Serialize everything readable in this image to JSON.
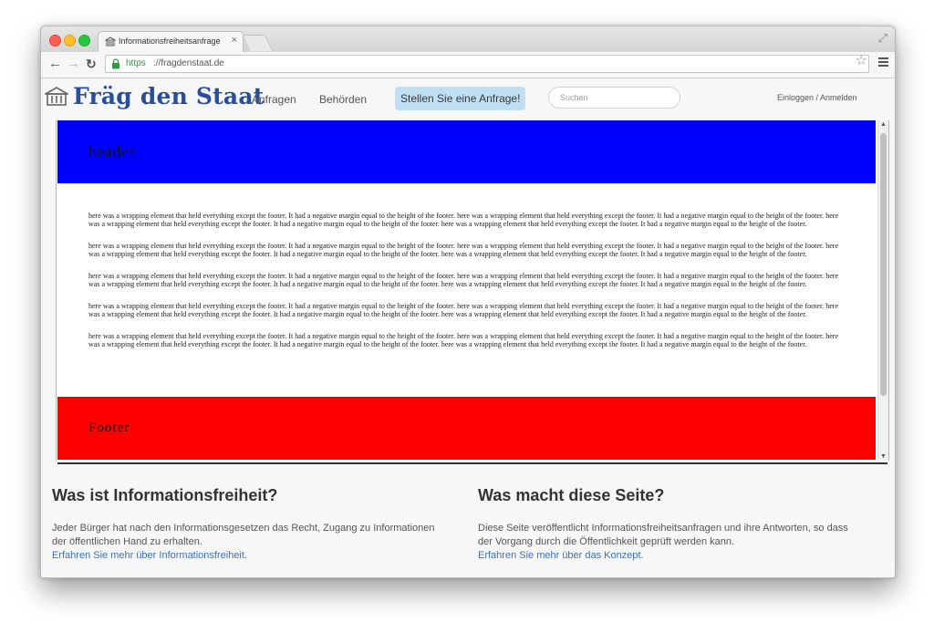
{
  "browser": {
    "tab_title": "Informationsfreiheitsanfrage",
    "tab_close": "×",
    "url_https": "https",
    "url_rest": "://fragdenstaat.de"
  },
  "site": {
    "brand": "Fräg den Staat",
    "nav": {
      "anfragen": "Anfragen",
      "behoerden": "Behörden",
      "cta": "Stellen Sie eine Anfrage!",
      "search_placeholder": "Suchen",
      "login": "Einloggen / Anmelden"
    }
  },
  "demo": {
    "header_label": "header",
    "paragraphs": [
      "here was a wrapping element that held everything except the footer. It had a negative margin equal to the height of the footer. here was a wrapping element that held everything except the footer. It had a negative margin equal to the height of the footer. here was a wrapping element that held everything except the footer. It had a negative margin equal to the height of the footer. here was a wrapping element that held everything except the footer. It had a negative margin equal to the height of the footer.",
      "here was a wrapping element that held everything except the footer. It had a negative margin equal to the height of the footer. here was a wrapping element that held everything except the footer. It had a negative margin equal to the height of the footer. here was a wrapping element that held everything except the footer. It had a negative margin equal to the height of the footer. here was a wrapping element that held everything except the footer. It had a negative margin equal to the height of the footer.",
      "here was a wrapping element that held everything except the footer. It had a negative margin equal to the height of the footer. here was a wrapping element that held everything except the footer. It had a negative margin equal to the height of the footer. here was a wrapping element that held everything except the footer. It had a negative margin equal to the height of the footer. here was a wrapping element that held everything except the footer. It had a negative margin equal to the height of the footer.",
      "here was a wrapping element that held everything except the footer. It had a negative margin equal to the height of the footer. here was a wrapping element that held everything except the footer. It had a negative margin equal to the height of the footer. here was a wrapping element that held everything except the footer. It had a negative margin equal to the height of the footer. here was a wrapping element that held everything except the footer. It had a negative margin equal to the height of the footer.",
      "here was a wrapping element that held everything except the footer. It had a negative margin equal to the height of the footer. here was a wrapping element that held everything except the footer. It had a negative margin equal to the height of the footer. here was a wrapping element that held everything except the footer. It had a negative margin equal to the height of the footer. here was a wrapping element that held everything except the footer. It had a negative margin equal to the height of the footer."
    ],
    "footer_label": "Footer"
  },
  "info": {
    "left": {
      "title": "Was ist Informationsfreiheit?",
      "text": "Jeder Bürger hat nach den Informationsgesetzen das Recht, Zugang zu Informationen der öffentlichen Hand zu erhalten.",
      "link": "Erfahren Sie mehr über Informationsfreiheit."
    },
    "right": {
      "title": "Was macht diese Seite?",
      "text": "Diese Seite veröffentlicht Informationsfreiheitsanfragen und ihre Antworten, so dass der Vorgang durch die Öffentlichkeit geprüft werden kann.",
      "link": "Erfahren Sie mehr über das Konzept."
    }
  },
  "colors": {
    "brand": "#2a4f9a",
    "demo_header": "#0000ff",
    "demo_footer": "#ff0000",
    "cta_bg": "#bfe0f4",
    "link": "#3a72b7"
  }
}
